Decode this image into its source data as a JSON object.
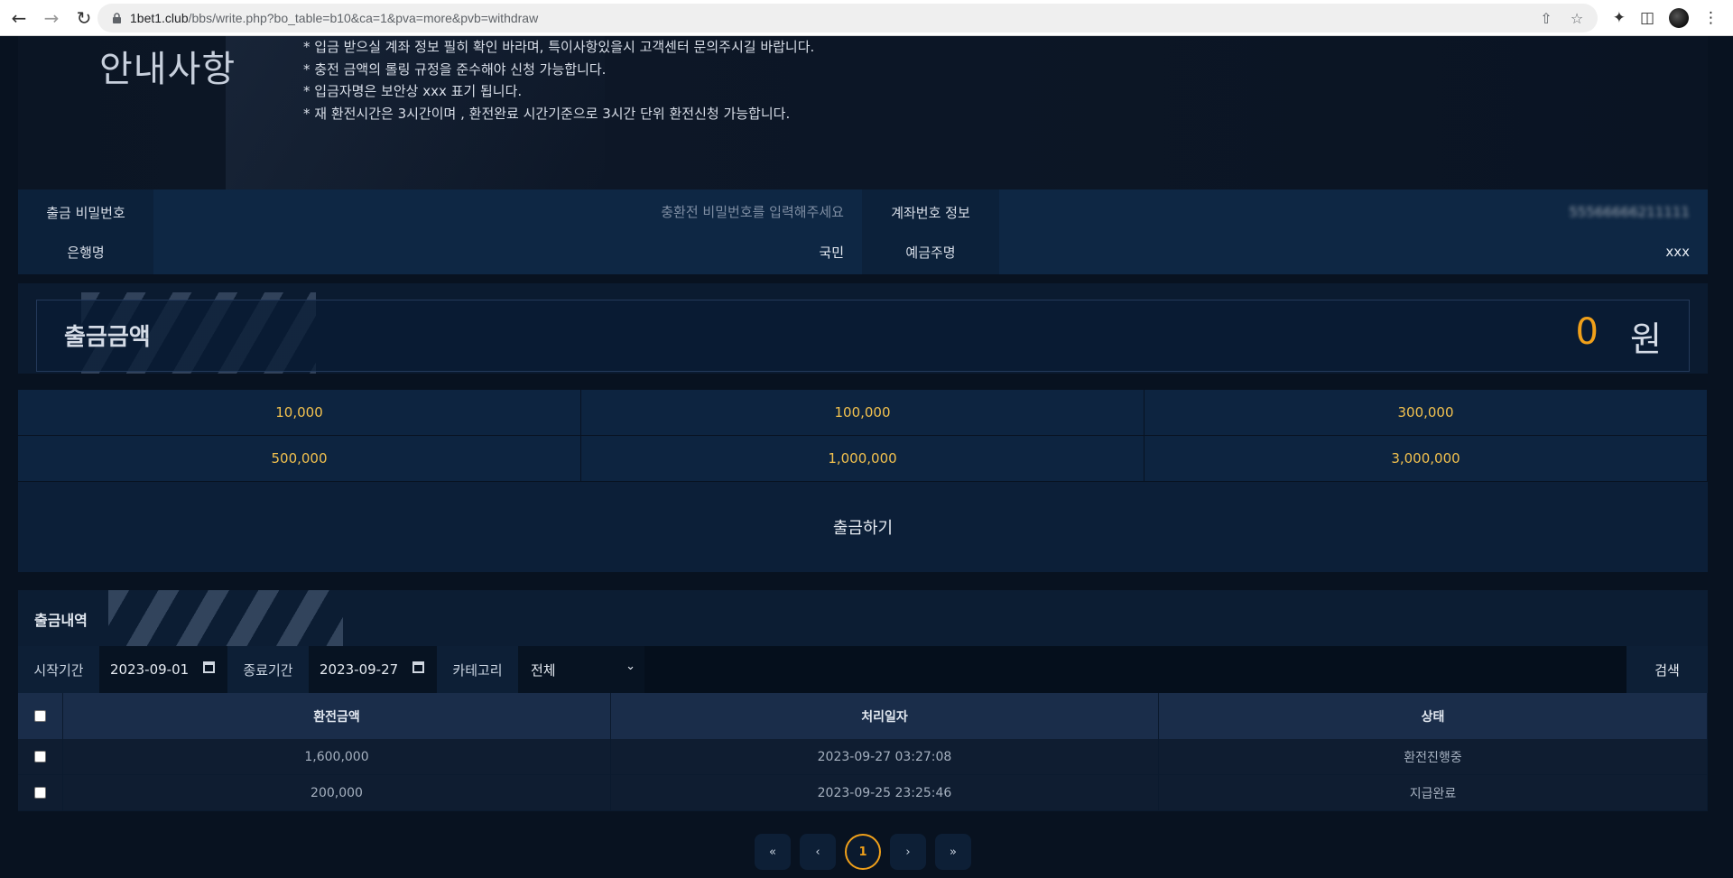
{
  "browser": {
    "url_host": "1bet1.club",
    "url_path": "/bbs/write.php?bo_table=b10&ca=1&pva=more&pvb=withdraw"
  },
  "notice": {
    "title": "안내사항",
    "lines": [
      "* 입금 받으실 계좌 정보 필히 확인 바라며, 특이사항있을시 고객센터 문의주시길 바랍니다.",
      "* 충전 금액의 롤링 규정을 준수해야 신청 가능합니다.",
      "* 입금자명은 보안상 xxx 표기 됩니다.",
      "* 재 환전시간은 3시간이며 , 환전완료 시간기준으로 3시간 단위 환전신청 가능합니다."
    ]
  },
  "form": {
    "password_label": "출금 비밀번호",
    "password_placeholder": "충환전 비밀번호를 입력해주세요",
    "account_label": "계좌번호 정보",
    "account_value": "55566666211111",
    "bank_label": "은행명",
    "bank_value": "국민",
    "holder_label": "예금주명",
    "holder_value": "xxx"
  },
  "amount": {
    "label": "출금금액",
    "value": "0",
    "unit": "원"
  },
  "quick_amounts": [
    "10,000",
    "100,000",
    "300,000",
    "500,000",
    "1,000,000",
    "3,000,000"
  ],
  "withdraw_button": "출금하기",
  "history": {
    "title": "출금내역",
    "start_label": "시작기간",
    "start_date": "2023-09-01",
    "end_label": "종료기간",
    "end_date": "2023-09-27",
    "category_label": "카테고리",
    "category_value": "전체",
    "search_label": "검색",
    "columns": [
      "환전금액",
      "처리일자",
      "상태"
    ],
    "rows": [
      {
        "amount": "1,600,000",
        "date": "2023-09-27 03:27:08",
        "status": "환전진행중"
      },
      {
        "amount": "200,000",
        "date": "2023-09-25 23:25:46",
        "status": "지급완료"
      }
    ]
  },
  "pagination": {
    "first": "«",
    "prev": "‹",
    "current": "1",
    "next": "›",
    "last": "»"
  },
  "colors": {
    "accent": "#f0a01a",
    "quick_amount_text": "#f2c14e",
    "page_bg": "#081220"
  }
}
